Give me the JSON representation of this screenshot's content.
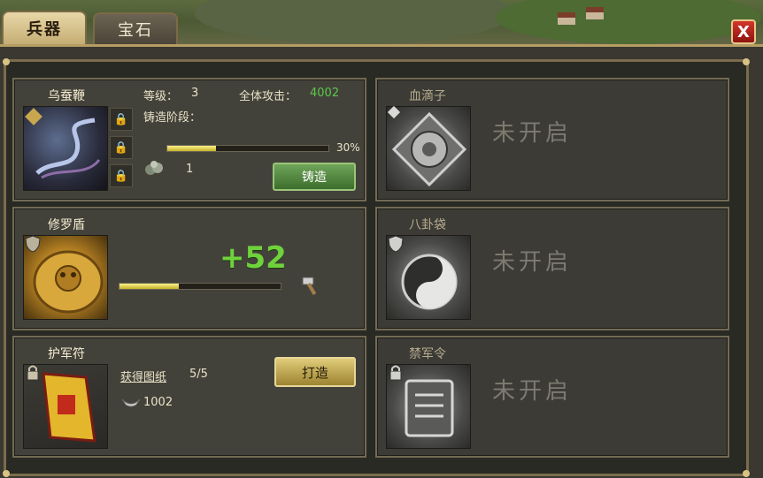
{
  "tabs": [
    {
      "label": "兵器",
      "active": true
    },
    {
      "label": "宝石",
      "active": false
    }
  ],
  "close_label": "X",
  "items": {
    "whip": {
      "name": "乌蚕鞭",
      "level_label": "等级：",
      "level_value": "3",
      "attack_label": "全体攻击：",
      "attack_value": "4002",
      "forge_stage_label": "铸造阶段：",
      "progress_percent_text": "30%",
      "progress": 0.3,
      "material_count": "1",
      "forge_button": "铸造"
    },
    "shield": {
      "name": "修罗盾",
      "bonus_text": "+52",
      "progress": 0.37
    },
    "talisman": {
      "name": "护军符",
      "get_blueprint_link": "获得图纸",
      "blueprint_count": "5/5",
      "silver_amount": "1002",
      "make_button": "打造"
    },
    "blood_drop": {
      "name": "血滴子",
      "status": "未开启"
    },
    "bagua_bag": {
      "name": "八卦袋",
      "status": "未开启"
    },
    "guard_order": {
      "name": "禁军令",
      "status": "未开启"
    }
  },
  "colors": {
    "accent_gold": "#c6ae74",
    "bonus_green": "#6fd23c",
    "attack_green": "#5ac84a",
    "close_red": "#d2372c"
  }
}
